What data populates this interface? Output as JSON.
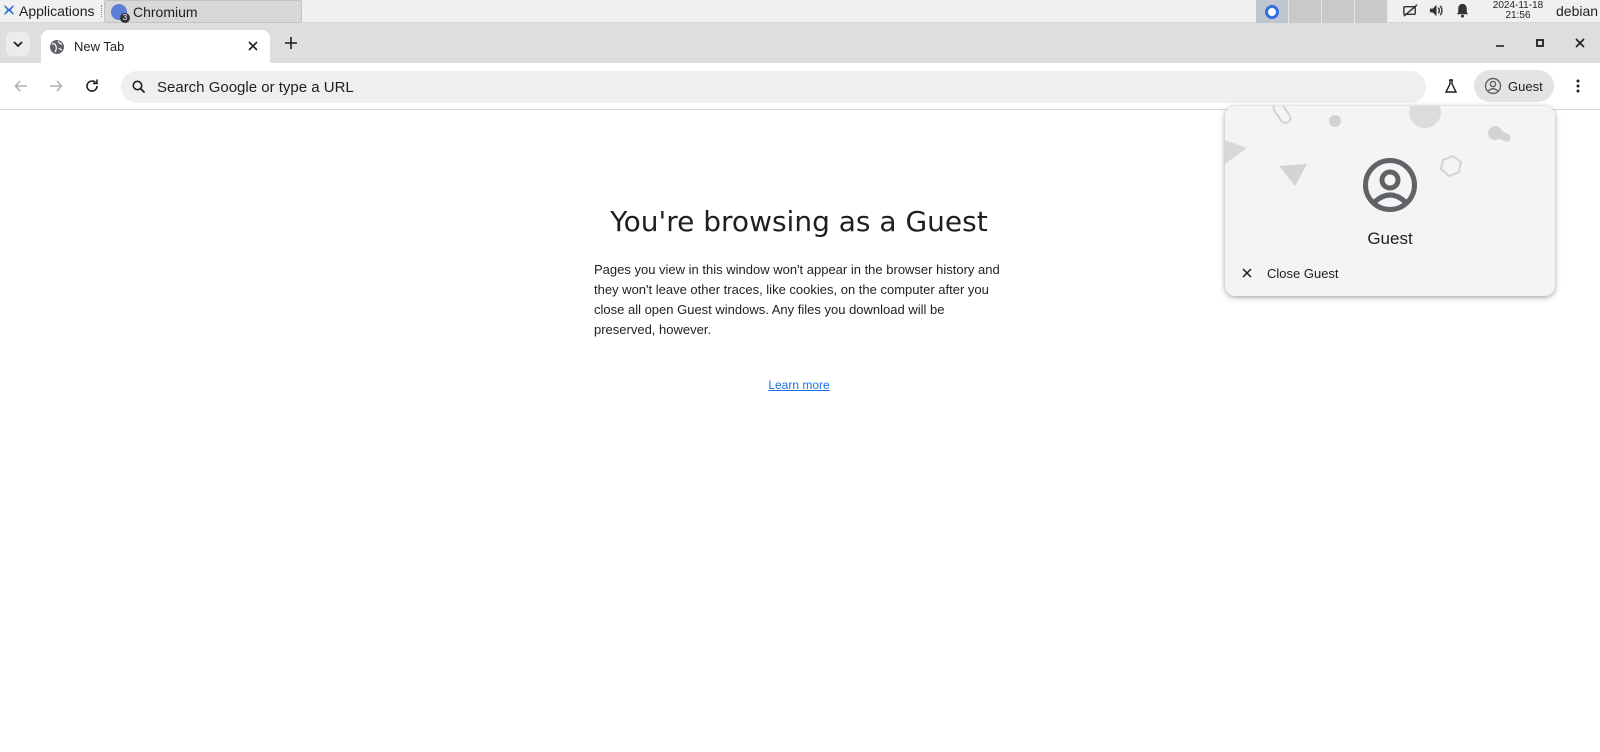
{
  "taskbar": {
    "apps_label": "Applications",
    "task_label": "Chromium",
    "clock_date": "2024-11-18",
    "clock_time": "21:56",
    "user": "debian"
  },
  "browser": {
    "tab_title": "New Tab",
    "omnibox_placeholder": "Search Google or type a URL",
    "profile_label": "Guest"
  },
  "page": {
    "title": "You're browsing as a Guest",
    "description": "Pages you view in this window won't appear in the browser history and they won't leave other traces, like cookies, on the computer after you close all open Guest windows. Any files you download will be preserved, however.",
    "learn_more": "Learn more"
  },
  "profile_menu": {
    "name": "Guest",
    "close_label": "Close Guest"
  },
  "colors": {
    "accent_link": "#1a73e8",
    "icon_gray": "#5f6368"
  }
}
